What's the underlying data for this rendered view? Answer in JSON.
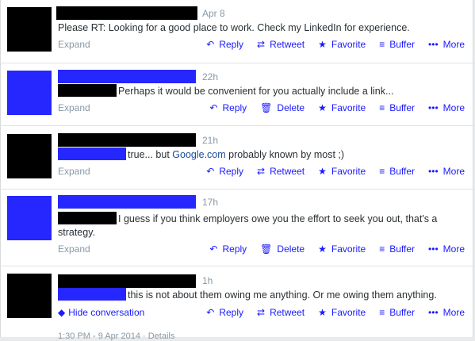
{
  "tweets": [
    {
      "time": "Apr 8",
      "text": "Please RT: Looking for a good place to work. Check my LinkedIn for experience.",
      "footer_left": "Expand",
      "actions": [
        "Reply",
        "Retweet",
        "Favorite",
        "Buffer",
        "More"
      ]
    },
    {
      "time": "22h",
      "text": "Perhaps it would be convenient for you actually include a link...",
      "footer_left": "Expand",
      "actions": [
        "Reply",
        "Delete",
        "Favorite",
        "Buffer",
        "More"
      ]
    },
    {
      "time": "21h",
      "text_a": "true... but ",
      "link": "Google.com",
      "text_b": " probably known by most ;)",
      "footer_left": "Expand",
      "actions": [
        "Reply",
        "Retweet",
        "Favorite",
        "Buffer",
        "More"
      ]
    },
    {
      "time": "17h",
      "text": "I guess if you think employers owe you the effort to seek you out, that's a strategy.",
      "footer_left": "Expand",
      "actions": [
        "Reply",
        "Delete",
        "Favorite",
        "Buffer",
        "More"
      ]
    },
    {
      "time": "1h",
      "text": "this is not about them owing me anything. Or me owing them anything.",
      "footer_left": "Hide conversation",
      "actions": [
        "Reply",
        "Retweet",
        "Favorite",
        "Buffer",
        "More"
      ]
    }
  ],
  "tail_text": "1:30 PM - 9 Apr 2014 · Details",
  "icons": {
    "reply": "reply-icon",
    "retweet": "retweet-icon",
    "delete": "trash-icon",
    "favorite": "star-icon",
    "buffer": "buffer-icon",
    "more": "more-icon",
    "conversation": "speech-bubble-icon"
  },
  "colors": {
    "action_blue": "#1a1aff",
    "avatar_blue": "#2626ff",
    "muted": "#8899a6"
  }
}
